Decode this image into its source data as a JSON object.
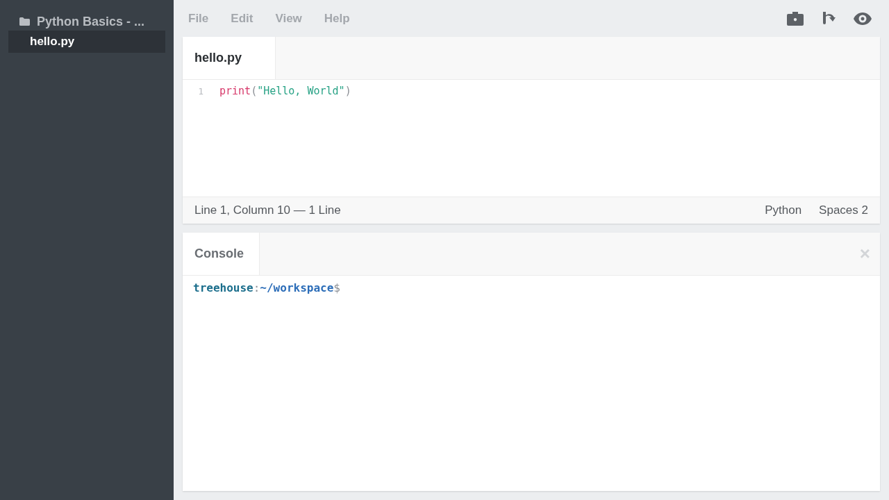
{
  "sidebar": {
    "project": {
      "name": "Python Basics - ..."
    },
    "files": [
      {
        "name": "hello.py",
        "selected": true
      }
    ]
  },
  "menu_bar": {
    "items": [
      "File",
      "Edit",
      "View",
      "Help"
    ]
  },
  "editor": {
    "tabs": [
      {
        "label": "hello.py",
        "selected": true
      }
    ],
    "lines": [
      {
        "number": "1",
        "tokens": [
          {
            "kind": "builtin",
            "text": "print"
          },
          {
            "kind": "punct",
            "text": "("
          },
          {
            "kind": "string",
            "text": "\"Hello, World\""
          },
          {
            "kind": "punct",
            "text": ")"
          }
        ]
      }
    ],
    "status_bar": {
      "position": "Line 1, Column 10 — 1 Line",
      "language": "Python",
      "indent": "Spaces 2"
    }
  },
  "console": {
    "tabs": [
      {
        "label": "Console",
        "selected": true
      }
    ],
    "close": "×",
    "prompt": [
      {
        "kind": "user",
        "text": "treehouse"
      },
      {
        "kind": "punct",
        "text": ":"
      },
      {
        "kind": "path",
        "text": "~/workspace"
      },
      {
        "kind": "punct",
        "text": "$"
      }
    ]
  }
}
